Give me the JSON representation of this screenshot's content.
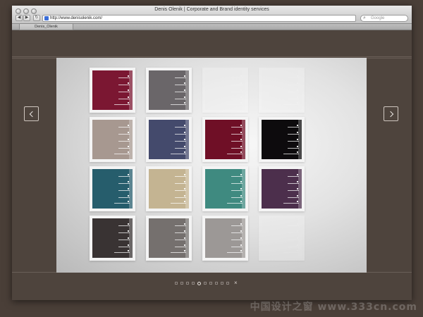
{
  "window": {
    "title": "Denis Olenik | Corporate and Brand identity services",
    "url": "http://www.denisolenik.com/",
    "search_placeholder": "Google",
    "tab_label": "Denis_Olenik"
  },
  "nav": {
    "prev_icon": "chevron-left-icon",
    "next_icon": "chevron-right-icon",
    "close_glyph": "×"
  },
  "gallery": {
    "cards": [
      {
        "color": "#7b1732",
        "empty": false
      },
      {
        "color": "#6a6669",
        "empty": false
      },
      {
        "color": "#e6e6e6",
        "empty": true
      },
      {
        "color": "#e6e6e6",
        "empty": true
      },
      {
        "color": "#a79890",
        "empty": false
      },
      {
        "color": "#444a6c",
        "empty": false
      },
      {
        "color": "#6f0f26",
        "empty": false
      },
      {
        "color": "#0d0b0d",
        "empty": false
      },
      {
        "color": "#265d6c",
        "empty": false
      },
      {
        "color": "#c4b492",
        "empty": false
      },
      {
        "color": "#3f8a80",
        "empty": false
      },
      {
        "color": "#4c2f4c",
        "empty": false
      },
      {
        "color": "#393333",
        "empty": false
      },
      {
        "color": "#75706e",
        "empty": false
      },
      {
        "color": "#9c9896",
        "empty": false
      },
      {
        "color": "#e6e6e6",
        "empty": true
      }
    ]
  },
  "pager": {
    "count": 10,
    "active_index": 4
  },
  "watermark": "中国设计之窗 www.333cn.com"
}
